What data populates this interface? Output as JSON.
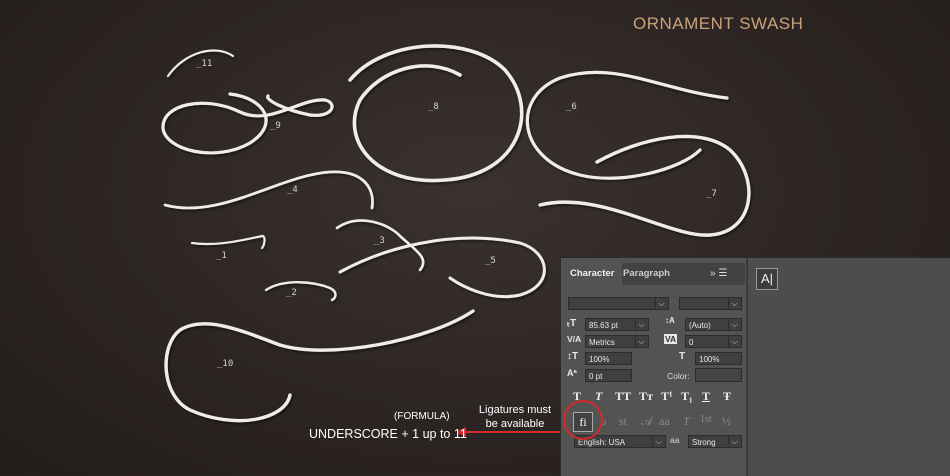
{
  "title": "ORNAMENT SWASH",
  "swash_labels": {
    "l1": "_1",
    "l2": "_2",
    "l3": "_3",
    "l4": "_4",
    "l5": "_5",
    "l6": "_6",
    "l7": "_7",
    "l8": "_8",
    "l9": "_9",
    "l10": "_10",
    "l11": "_11"
  },
  "formula_note": {
    "heading": "(FORMULA)",
    "text": "UNDERSCORE + 1 up to 11"
  },
  "ligature_note": {
    "line1": "Ligatures must",
    "line2": "be available"
  },
  "panel": {
    "tabs": [
      "Character",
      "Paragraph"
    ],
    "menu_icons": "»  ☰",
    "side_button": "A|",
    "font_family": "",
    "font_style": "",
    "size": "85.63 pt",
    "leading": "(Auto)",
    "kerning": "Metrics",
    "tracking": "0",
    "vertical_scale": "100%",
    "horizontal_scale": "100%",
    "baseline_shift": "0 pt",
    "color_label": "Color:",
    "language": "English: USA",
    "antialias_icon": "aa",
    "antialias": "Strong",
    "style_glyphs": [
      "T",
      "T",
      "TT",
      "Tт",
      "T¹",
      "T₁",
      "T",
      "Ŧ"
    ],
    "opentype_glyphs": [
      "fi",
      "ℴ",
      "st",
      "𝒜",
      "aa",
      "T",
      "1st",
      "½"
    ]
  },
  "colors": {
    "accent": "#c9a27a",
    "highlight": "#d42a2a",
    "swash": "#f1ece4"
  }
}
